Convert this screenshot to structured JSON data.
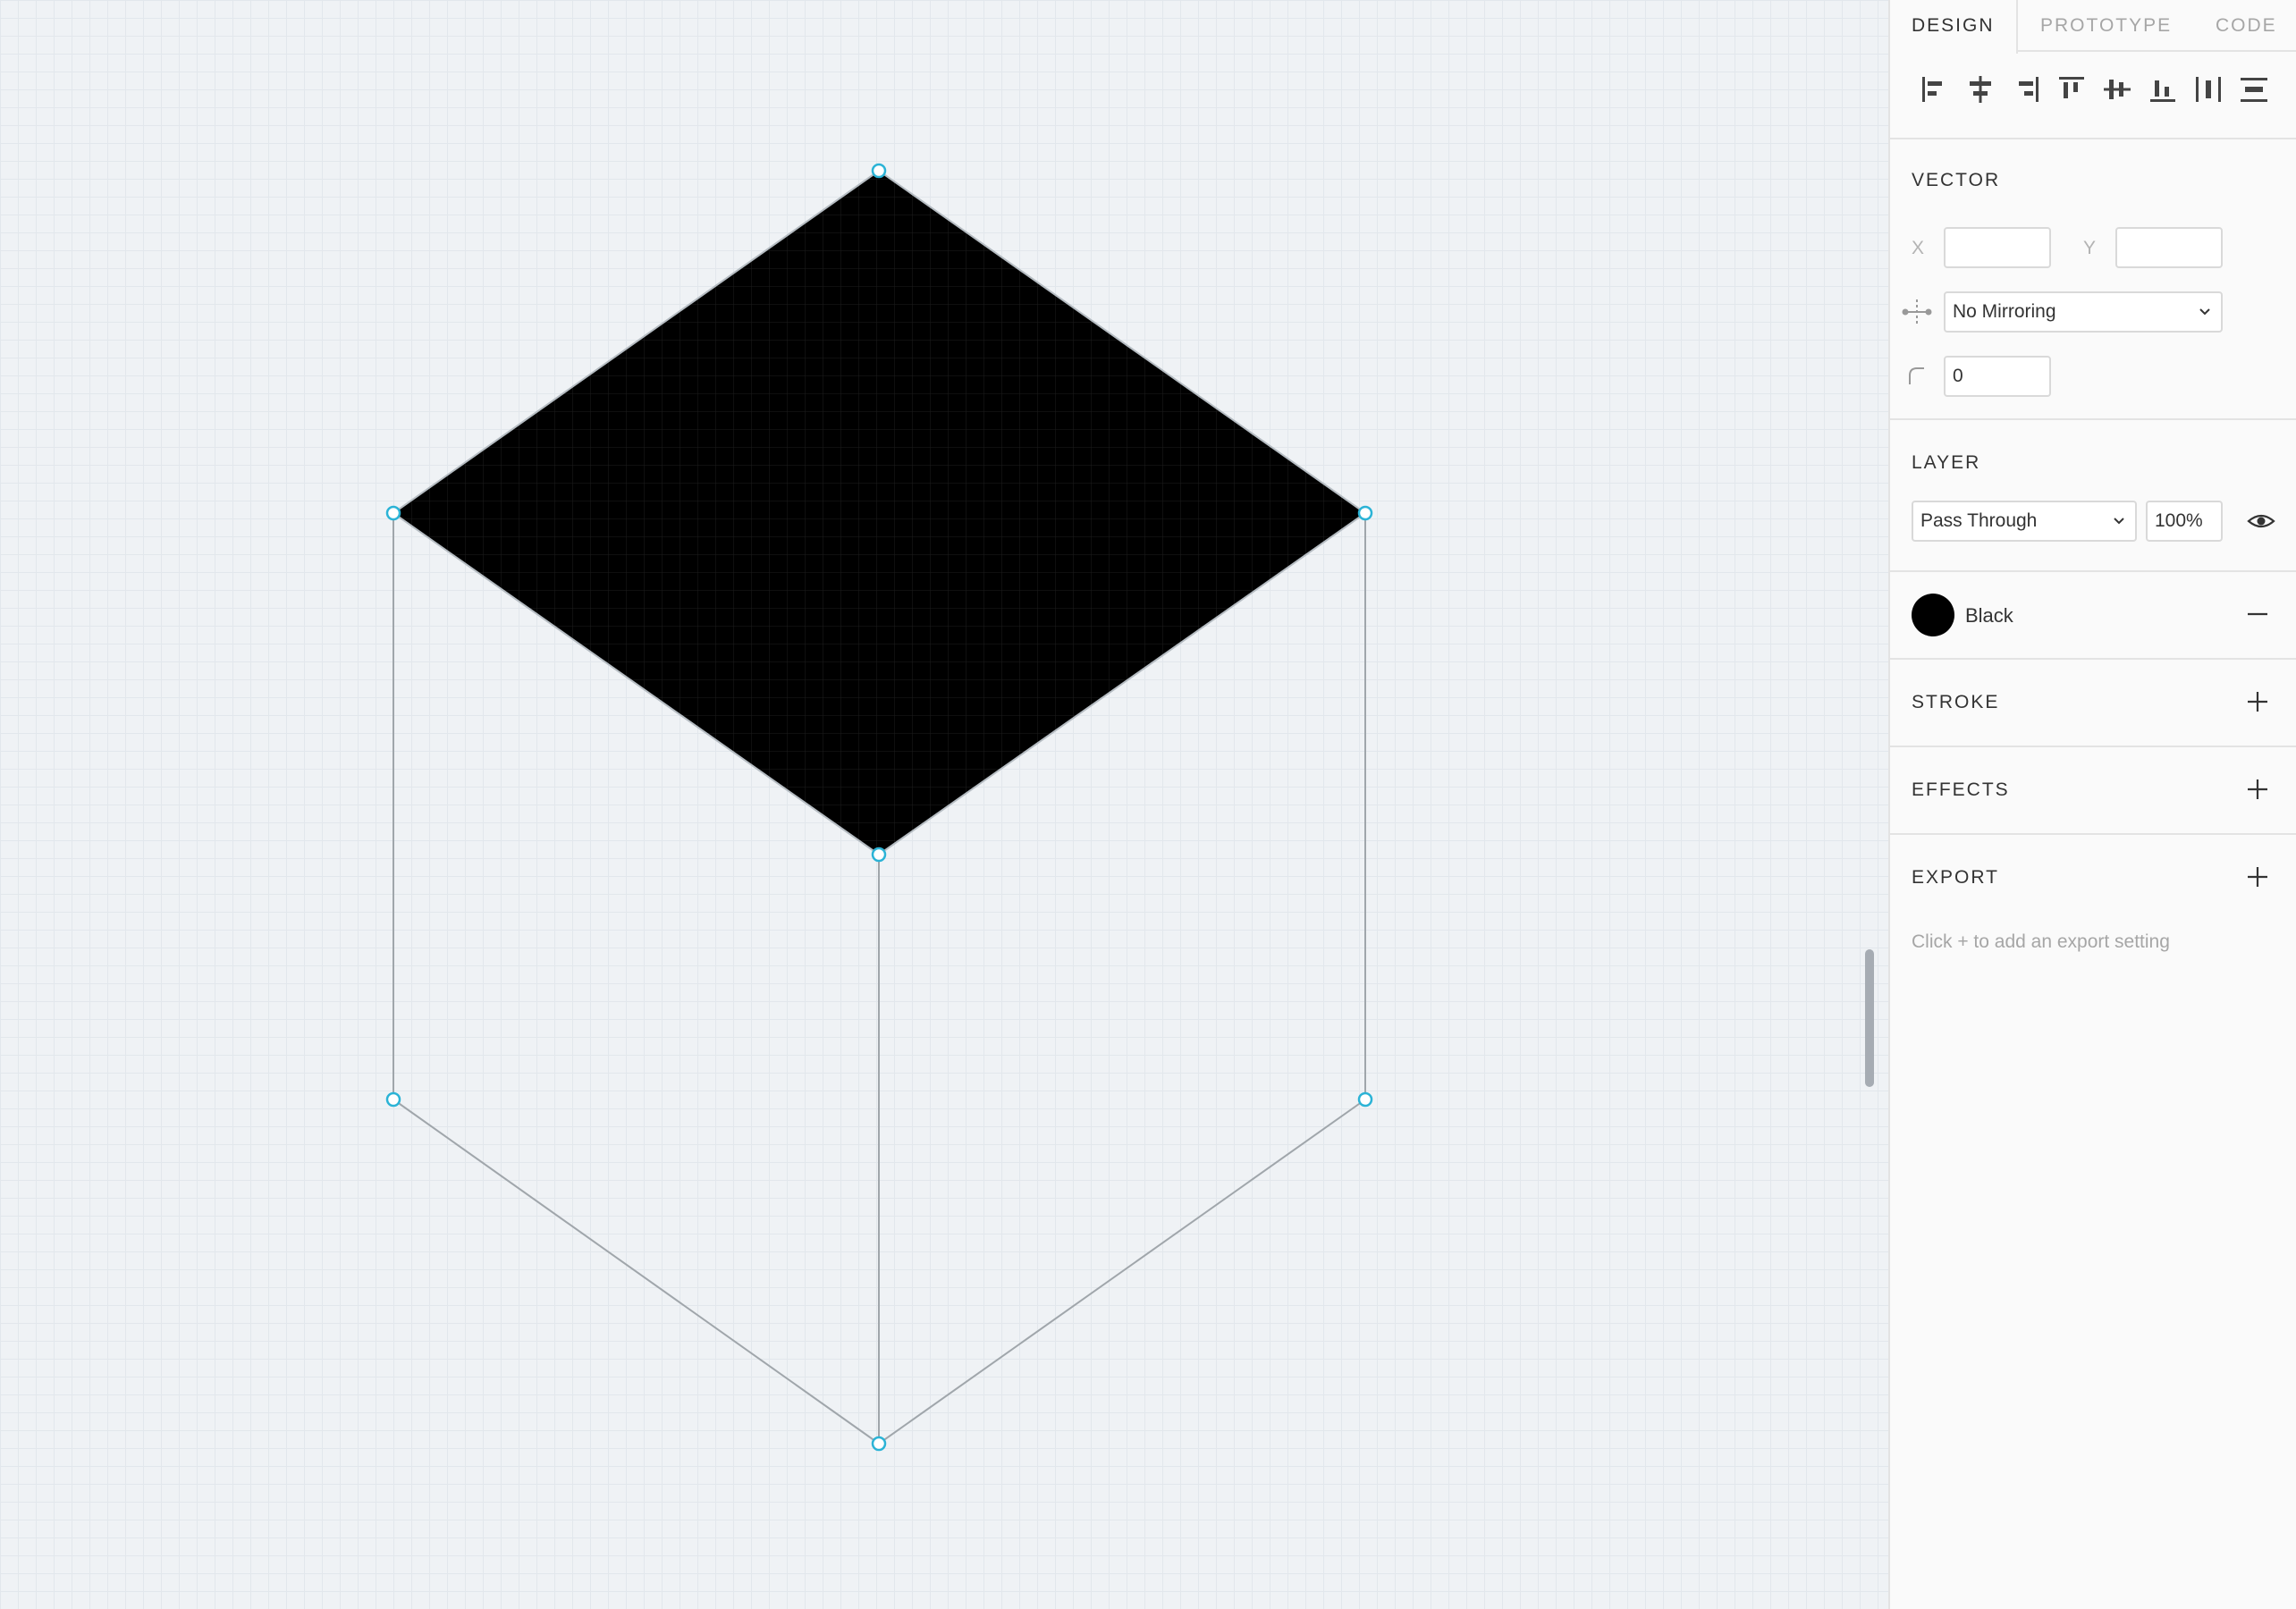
{
  "tabs": {
    "design": "DESIGN",
    "prototype": "PROTOTYPE",
    "code": "CODE"
  },
  "vector": {
    "title": "VECTOR",
    "x_label": "X",
    "x_value": "",
    "y_label": "Y",
    "y_value": "",
    "mirroring": "No Mirroring",
    "corner_radius": "0"
  },
  "layer": {
    "title": "LAYER",
    "blend_mode": "Pass Through",
    "opacity": "100%"
  },
  "fill": {
    "name": "Black",
    "color": "#000000"
  },
  "stroke": {
    "title": "STROKE"
  },
  "effects": {
    "title": "EFFECTS"
  },
  "export": {
    "title": "EXPORT",
    "hint": "Click + to add an export setting"
  },
  "colors": {
    "accent_handle": "#2bb3d6",
    "outline": "#a0a6ab",
    "panel_bg": "#fafafa"
  },
  "icons": {
    "align": [
      "align-left-icon",
      "align-horizontal-center-icon",
      "align-right-icon",
      "align-top-icon",
      "align-vertical-center-icon",
      "align-bottom-icon",
      "distribute-horizontal-icon",
      "distribute-vertical-icon"
    ],
    "other": [
      "mirroring-icon",
      "corner-radius-icon",
      "eye-icon",
      "minus-icon",
      "plus-icon",
      "chevron-down-icon"
    ]
  }
}
